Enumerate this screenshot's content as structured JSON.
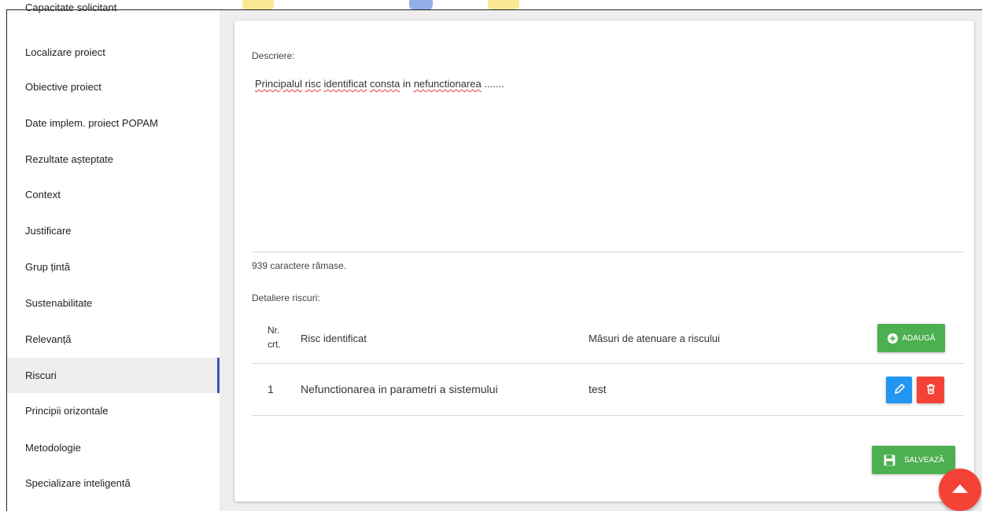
{
  "sidebar": {
    "items": [
      {
        "label": "Capacitate solicitant"
      },
      {
        "label": "Localizare proiect"
      },
      {
        "label": "Obiective proiect"
      },
      {
        "label": "Date implem. proiect POPAM"
      },
      {
        "label": "Rezultate așteptate"
      },
      {
        "label": "Context"
      },
      {
        "label": "Justificare"
      },
      {
        "label": "Grup țintă"
      },
      {
        "label": "Sustenabilitate"
      },
      {
        "label": "Relevanță"
      },
      {
        "label": "Riscuri"
      },
      {
        "label": "Principii orizontale"
      },
      {
        "label": "Metodologie"
      },
      {
        "label": "Specializare inteligentă"
      }
    ],
    "active": "Riscuri"
  },
  "form": {
    "description_label": "Descriere:",
    "description_words": [
      "Principalul",
      "risc",
      "identificat",
      "consta",
      "in",
      "nefunctionarea",
      "......."
    ],
    "chars_remaining": "939 caractere rămase.",
    "risks_label": "Detaliere riscuri:"
  },
  "table": {
    "headers": {
      "nr": "Nr.",
      "crt": "crt.",
      "risk": "Risc identificat",
      "measures": "Măsuri de atenuare a riscului"
    },
    "rows": [
      {
        "nr": "1",
        "risk": "Nefunctionarea in parametri a sistemului",
        "measures": "test"
      }
    ]
  },
  "buttons": {
    "add": "ADAUGĂ",
    "save": "SALVEAZĂ"
  },
  "colors": {
    "primary_green": "#4caf50",
    "edit_blue": "#2196f3",
    "delete_red": "#f44336",
    "active_indicator": "#3f51b5"
  },
  "icons": {
    "add": "plus-circle-icon",
    "edit": "pencil-icon",
    "delete": "trash-icon",
    "save": "floppy-icon",
    "fab": "arrow-up-icon"
  }
}
